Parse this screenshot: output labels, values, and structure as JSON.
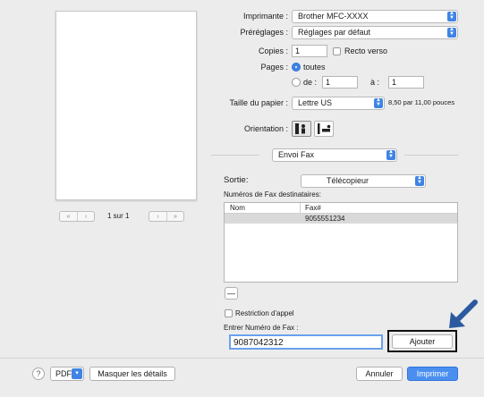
{
  "preview": {
    "page_indicator": "1 sur 1",
    "first_glyph": "«",
    "prev_glyph": "‹",
    "next_glyph": "›",
    "last_glyph": "»"
  },
  "printer": {
    "label": "Imprimante :",
    "value": "Brother MFC-XXXX"
  },
  "presets": {
    "label": "Préréglages :",
    "value": "Réglages par défaut"
  },
  "copies": {
    "label": "Copies :",
    "value": "1",
    "duplex_label": "Recto verso"
  },
  "pages": {
    "label": "Pages :",
    "all_label": "toutes",
    "from_label": "de :",
    "from_value": "1",
    "to_label": "à :",
    "to_value": "1"
  },
  "paper": {
    "label": "Taille du papier :",
    "value": "Lettre US",
    "size_text": "8,50 par 11,00 pouces"
  },
  "orientation": {
    "label": "Orientation :"
  },
  "section_select": {
    "value": "Envoi Fax"
  },
  "output": {
    "label": "Sortie:",
    "value": "Télécopieur"
  },
  "fax_list": {
    "title": "Numéros de Fax destinataires:",
    "col_name": "Nom",
    "col_fax": "Fax#",
    "rows": [
      {
        "name": "",
        "fax": "9055551234"
      }
    ],
    "remove_glyph": "—"
  },
  "dial_restriction": {
    "label": "Restriction d'appel"
  },
  "fax_entry": {
    "label": "Entrer Numéro de Fax :",
    "value": "9087042312",
    "add_label": "Ajouter"
  },
  "footer": {
    "help_glyph": "?",
    "pdf_label": "PDF",
    "hide_details_label": "Masquer les détails",
    "cancel_label": "Annuler",
    "print_label": "Imprimer"
  },
  "colors": {
    "accent": "#3f84e4",
    "annotation_arrow": "#2c5aa0"
  }
}
